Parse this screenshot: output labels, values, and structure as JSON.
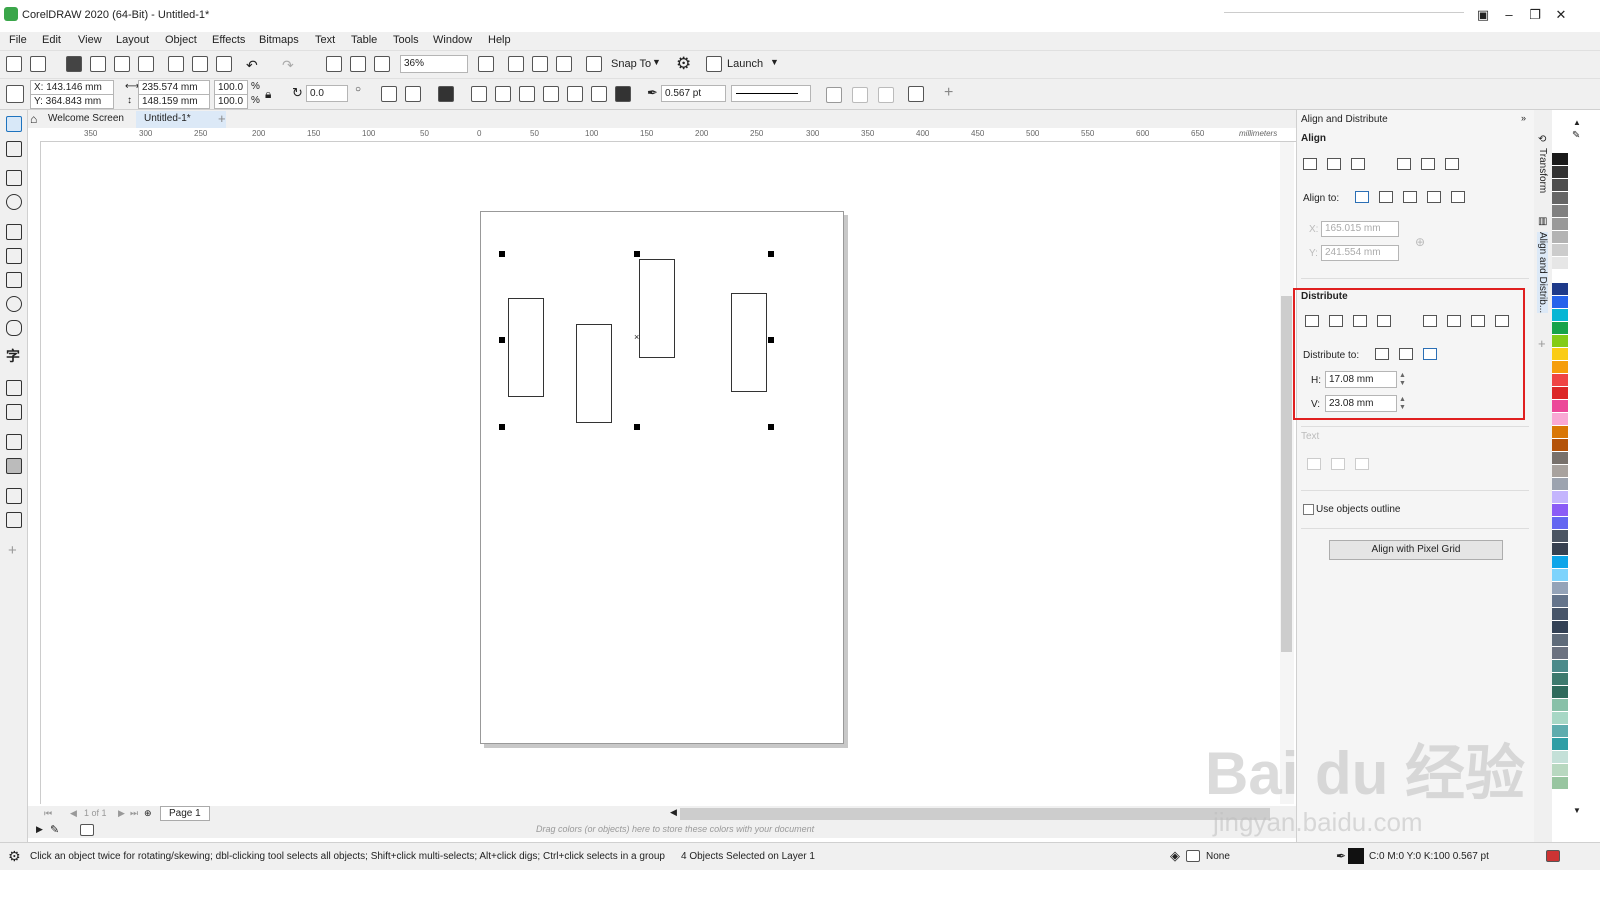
{
  "window": {
    "title": "CorelDRAW 2020 (64-Bit) - Untitled-1*"
  },
  "menu": [
    "File",
    "Edit",
    "View",
    "Layout",
    "Object",
    "Effects",
    "Bitmaps",
    "Text",
    "Table",
    "Tools",
    "Window",
    "Help"
  ],
  "toolbar": {
    "zoom": "36%",
    "snap_to": "Snap To",
    "launch": "Launch"
  },
  "properties": {
    "x": "X: 143.146 mm",
    "y": "Y: 364.843 mm",
    "width": "235.574 mm",
    "height": "148.159 mm",
    "scale_w": "100.0",
    "scale_h": "100.0",
    "percent": "%",
    "rotation": "0.0",
    "outline_width": "0.567 pt"
  },
  "tabs": [
    {
      "label": "Welcome Screen"
    },
    {
      "label": "Untitled-1*"
    }
  ],
  "ruler": {
    "unit": "millimeters",
    "h_ticks": [
      "350",
      "300",
      "250",
      "200",
      "150",
      "100",
      "50",
      "0",
      "50",
      "100",
      "150",
      "200",
      "250",
      "300",
      "350",
      "400",
      "450",
      "500",
      "550",
      "600",
      "650",
      "700"
    ]
  },
  "page_nav": {
    "counter": "1 of 1",
    "page_tab": "Page 1"
  },
  "color_dock_hint": "Drag colors (or objects) here to store these colors with your document",
  "status": {
    "hint": "Click an object twice for rotating/skewing; dbl-clicking tool selects all objects; Shift+click multi-selects; Alt+click digs; Ctrl+click selects in a group",
    "selection": "4 Objects Selected on Layer 1",
    "fill": "None",
    "outline": "C:0 M:0 Y:0 K:100  0.567 pt"
  },
  "docker": {
    "title": "Align and Distribute",
    "align_label": "Align",
    "align_to_label": "Align to:",
    "x_value": "165.015 mm",
    "y_value": "241.554 mm",
    "distribute_label": "Distribute",
    "distribute_to_label": "Distribute to:",
    "h_label": "H:",
    "h_value": "17.08 mm",
    "v_label": "V:",
    "v_value": "23.08 mm",
    "text_label": "Text",
    "use_outline_label": "Use objects outline",
    "pixel_grid_button": "Align with Pixel Grid"
  },
  "side_tabs": {
    "transform": "Transform",
    "align": "Align and Distrib..."
  },
  "watermark": {
    "main": "Bai du 经验",
    "sub": "jingyan.baidu.com"
  },
  "palette": [
    "#ffffff",
    "#1a1a1a",
    "#333333",
    "#4d4d4d",
    "#666666",
    "#808080",
    "#999999",
    "#b3b3b3",
    "#cccccc",
    "#e6e6e6",
    "#ffffff",
    "#1e3a8a",
    "#2563eb",
    "#06b6d4",
    "#16a34a",
    "#84cc16",
    "#facc15",
    "#f59e0b",
    "#ef4444",
    "#dc2626",
    "#ec4899",
    "#f9a8d4",
    "#d97706",
    "#b45309",
    "#78716c",
    "#a8a29e",
    "#9ca3af",
    "#c4b5fd",
    "#8b5cf6",
    "#6366f1",
    "#4b5563",
    "#374151",
    "#0ea5e9",
    "#7dd3fc",
    "#94a3b8",
    "#64748b",
    "#475569",
    "#334155",
    "#5f6b7a",
    "#6b7280",
    "#4b8a8a",
    "#3d7a6e",
    "#2f6b5c",
    "#88c0a8",
    "#a7d7c5",
    "#5eacae",
    "#2f9ea5",
    "#c4e0d8",
    "#b8d8c0",
    "#98c5a0"
  ]
}
